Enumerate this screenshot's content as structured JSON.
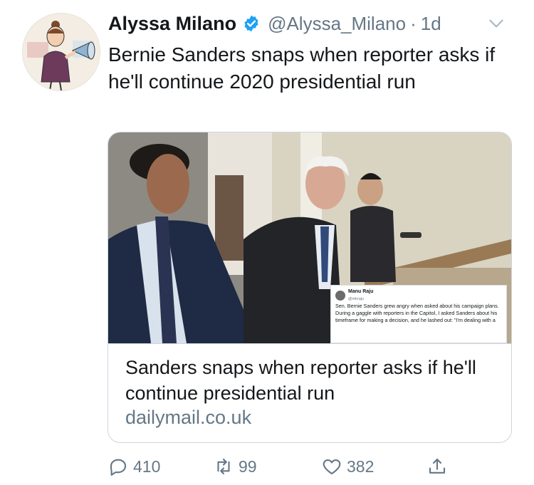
{
  "tweet": {
    "author_name": "Alyssa Milano",
    "handle": "@Alyssa_Milano",
    "separator": "·",
    "time": "1d",
    "text": "Bernie Sanders snaps when reporter asks if he'll continue 2020 presidential run"
  },
  "card": {
    "title": "Sanders snaps when reporter asks if he'll continue presidential run",
    "domain": "dailymail.co.uk",
    "embedded_tweet": {
      "name": "Manu Raju",
      "handle": "@mkraju",
      "text": "Sen. Bernie Sanders grew angry when asked about his campaign plans. During a gaggle with reporters in the Capitol, I asked Sanders about his timeframe for making a decision, and he lashed out: \"I'm dealing with a"
    }
  },
  "actions": {
    "reply_count": "410",
    "retweet_count": "99",
    "like_count": "382"
  },
  "colors": {
    "text": "#14171a",
    "muted": "#657786",
    "verified": "#1da1f2",
    "border": "#ccd6dd"
  },
  "icons": [
    "verified-badge-icon",
    "chevron-down-icon",
    "reply-icon",
    "retweet-icon",
    "like-icon",
    "share-icon"
  ]
}
